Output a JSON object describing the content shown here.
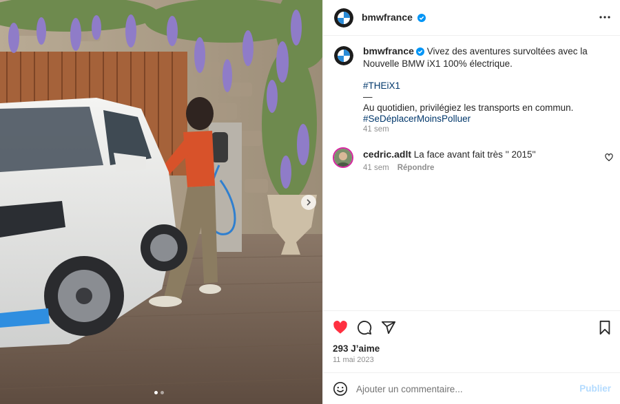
{
  "post": {
    "author": "bmwfrance",
    "caption_line1": "Vivez des aventures survoltées avec la",
    "caption_line2": "Nouvelle BMW iX1 100% électrique.",
    "hashtag1": "#THEiX1",
    "separator": "—",
    "caption_line3": "Au quotidien, privilégiez les transports en commun.",
    "hashtag2": "#SeDéplacerMoinsPolluer",
    "time": "41 sem"
  },
  "comments": [
    {
      "user": "cedric.adlt",
      "text": "La face avant fait très '' 2015''",
      "time": "41 sem",
      "reply_label": "Répondre"
    }
  ],
  "stats": {
    "likes": "293 J’aime",
    "date": "11 mai 2023"
  },
  "composer": {
    "placeholder": "Ajouter un commentaire...",
    "publish_label": "Publier"
  },
  "carousel": {
    "total": 2,
    "current": 1
  },
  "icons": {
    "verified": "verified-badge-icon",
    "more": "more-options-icon",
    "like": "heart-filled-icon",
    "comment": "comment-icon",
    "share": "share-icon",
    "save": "bookmark-icon",
    "emoji": "emoji-icon",
    "next": "chevron-right-icon",
    "comment_like": "heart-outline-icon"
  },
  "colors": {
    "accent": "#0095f6",
    "like": "#ff3040",
    "hashtag": "#00376b",
    "muted": "#8e8e8e"
  }
}
